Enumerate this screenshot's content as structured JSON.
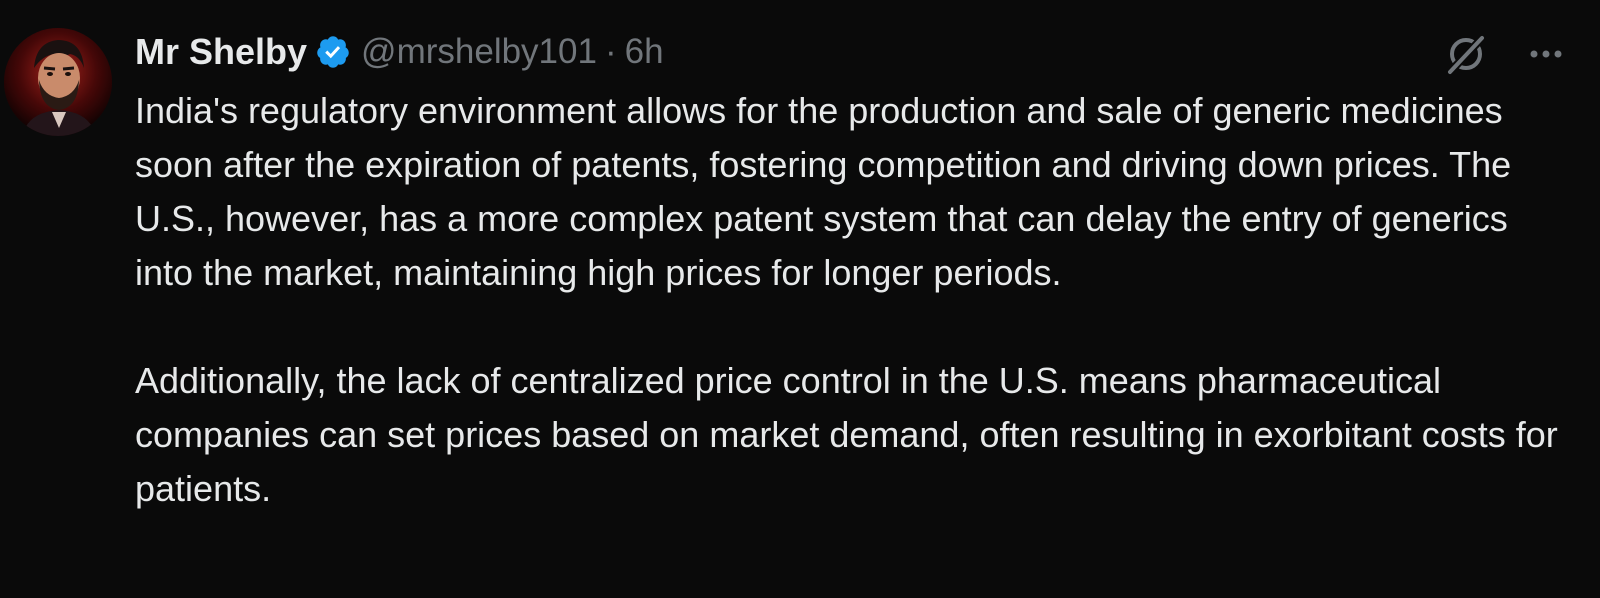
{
  "tweet": {
    "author": {
      "name": "Mr Shelby",
      "handle": "@mrshelby101",
      "verified_color": "#1d9bf0"
    },
    "separator": "·",
    "time": "6h",
    "actions": {
      "grok_icon": "grok-slash-icon",
      "more_icon": "more-horizontal-icon"
    },
    "paragraphs": [
      "India's regulatory environment allows for the production and sale of generic medicines soon after the expiration of patents, fostering competition and driving down prices. The U.S., however, has a more complex patent system that can delay the entry of generics into the market, maintaining high prices for longer periods.",
      "Additionally, the lack of centralized price control in the U.S. means pharmaceutical companies can set prices based on market demand, often resulting in exorbitant costs for patients."
    ]
  },
  "colors": {
    "background": "#0a0a0a",
    "text_primary": "#e7e9ea",
    "text_secondary": "#71767b"
  }
}
